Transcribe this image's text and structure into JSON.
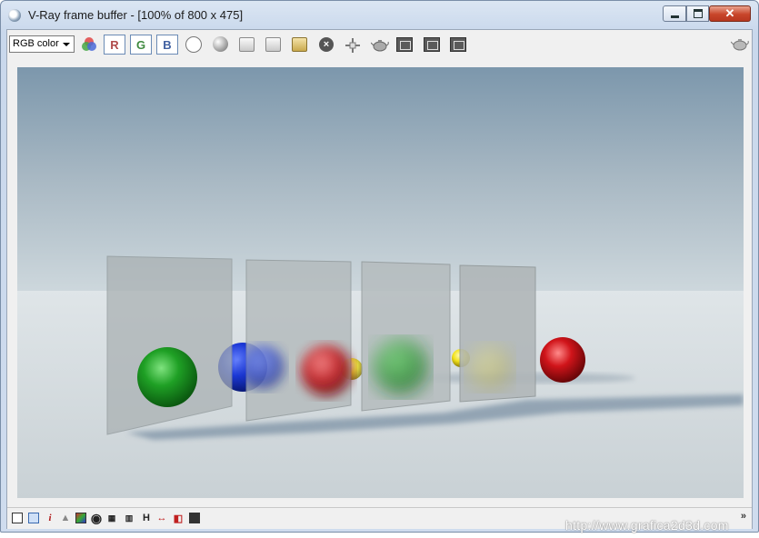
{
  "window": {
    "title": "V-Ray frame buffer - [100% of 800 x 475]",
    "minimize_label": "minimize",
    "maximize_label": "maximize",
    "close_label": "close"
  },
  "toolbar": {
    "channel_select": "RGB color",
    "red_label": "R",
    "green_label": "G",
    "blue_label": "B",
    "clear_label": "×"
  },
  "statusbar": {
    "info_label": "i",
    "h_label": "H",
    "expand_label": "»"
  },
  "watermark": "http://www.grafica2d3d.com",
  "colors": {
    "sky_top": "#7d97ab",
    "floor": "#d6dde1",
    "sphere_green": "#1fa025",
    "sphere_blue": "#1c38d6",
    "sphere_red": "#d0141a",
    "sphere_yellow": "#f2e21a"
  }
}
